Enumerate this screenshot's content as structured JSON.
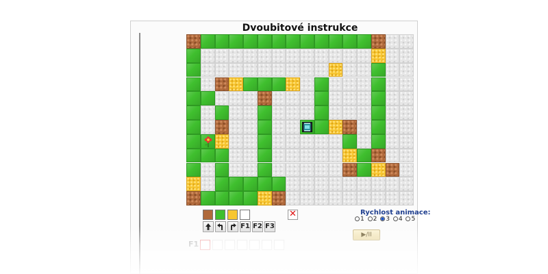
{
  "title": "Dvoubitové instrukce",
  "board": {
    "cols": 16,
    "rows": 12,
    "grid": [
      "bggggggggggggbww",
      "gwwwwwwwwwwwwyww",
      "gwwwwwwwwwywwgww",
      "gwbygggywgwwwgww",
      "ggwwwbwwwgwwwgww",
      "gwgwwgwwwgwwwgww",
      "gwbwwgwwrgybwgww",
      "gfywwgwwwwwgwgww",
      "gggwwgwwwwwygbww",
      "gwgwwgwwwwwbgyb w",
      "ywgggggwwwwwwwww",
      "bggggybwwwwwwwww"
    ]
  },
  "palette": [
    "brown",
    "green",
    "yellow",
    "white"
  ],
  "commands": [
    "F1",
    "F2",
    "F3"
  ],
  "speed": {
    "label": "Rychlost animace:",
    "options": [
      "1",
      "2",
      "3",
      "4",
      "5"
    ],
    "selected": "3"
  },
  "play_label": "▶/II",
  "program": {
    "label": "F1"
  },
  "colors": {
    "green": "#3fbf2e",
    "yellow": "#f7c631",
    "brown": "#b06a3c",
    "white": "#e6e6e6"
  }
}
